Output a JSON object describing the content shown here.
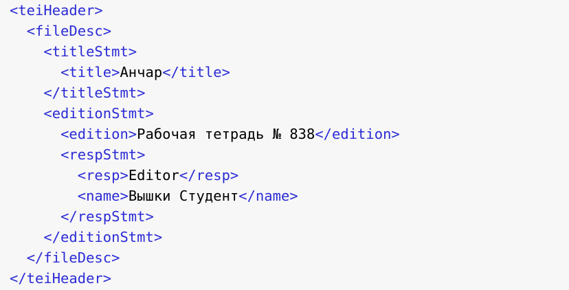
{
  "colors": {
    "background": "#f7f7f7",
    "tag": "#2b2bd6",
    "text": "#000000"
  },
  "lines": [
    {
      "indent": 0,
      "open": "<teiHeader>",
      "text": "",
      "close": ""
    },
    {
      "indent": 1,
      "open": "<fileDesc>",
      "text": "",
      "close": ""
    },
    {
      "indent": 2,
      "open": "<titleStmt>",
      "text": "",
      "close": ""
    },
    {
      "indent": 3,
      "open": "<title>",
      "text": "Анчар",
      "close": "</title>"
    },
    {
      "indent": 2,
      "open": "</titleStmt>",
      "text": "",
      "close": ""
    },
    {
      "indent": 2,
      "open": "<editionStmt>",
      "text": "",
      "close": ""
    },
    {
      "indent": 3,
      "open": "<edition>",
      "text": "Рабочая тетрадь № 838",
      "close": "</edition>"
    },
    {
      "indent": 3,
      "open": "<respStmt>",
      "text": "",
      "close": ""
    },
    {
      "indent": 4,
      "open": "<resp>",
      "text": "Editor",
      "close": "</resp>"
    },
    {
      "indent": 4,
      "open": "<name>",
      "text": "Вышки Студент",
      "close": "</name>"
    },
    {
      "indent": 3,
      "open": "</respStmt>",
      "text": "",
      "close": ""
    },
    {
      "indent": 2,
      "open": "</editionStmt>",
      "text": "",
      "close": ""
    },
    {
      "indent": 1,
      "open": "</fileDesc>",
      "text": "",
      "close": ""
    },
    {
      "indent": 0,
      "open": "</teiHeader>",
      "text": "",
      "close": ""
    }
  ]
}
